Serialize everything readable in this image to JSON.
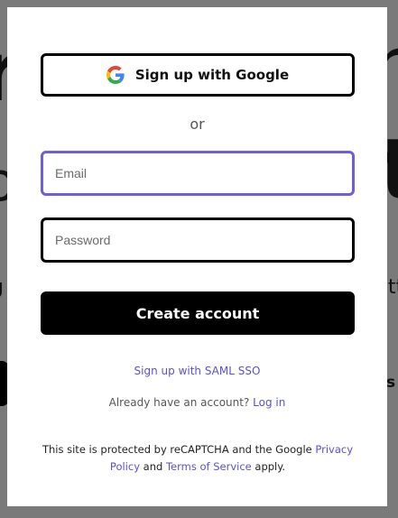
{
  "background": {
    "frag_big_left": "r",
    "frag_mid_left": "o",
    "frag_big_right": "n",
    "frag_mid_right": "t",
    "frag_text_left": "g",
    "frag_text_right": "tt",
    "frag_s_right": "s"
  },
  "signup": {
    "google_button_label": "Sign up with Google",
    "google_icon": "google-icon",
    "divider": "or",
    "email_placeholder": "Email",
    "email_value": "",
    "password_placeholder": "Password",
    "password_value": "",
    "create_button_label": "Create account",
    "saml_link": "Sign up with SAML SSO",
    "login_prompt": "Already have an account?",
    "login_link": "Log in",
    "recaptcha_prefix": "This site is protected by reCAPTCHA and the Google",
    "privacy_link": "Privacy Policy",
    "and": "and",
    "terms_link": "Terms of Service",
    "suffix": "apply."
  },
  "colors": {
    "accent": "#5b50d6",
    "focus_border": "#6b5fe0",
    "overlay": "#7a7a7a",
    "primary_button": "#000000"
  }
}
